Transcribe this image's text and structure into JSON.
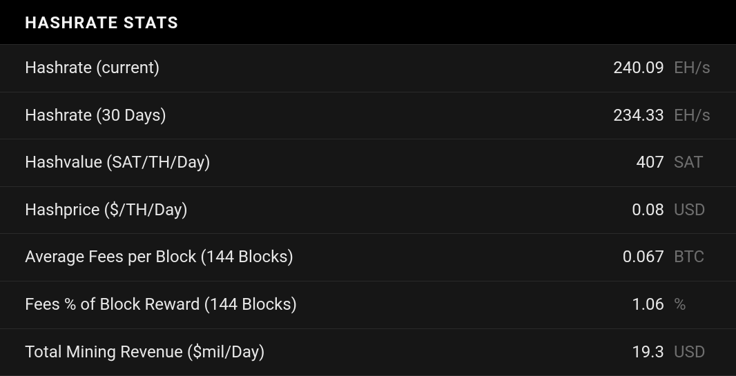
{
  "panel": {
    "title": "HASHRATE STATS",
    "rows": [
      {
        "label": "Hashrate (current)",
        "value": "240.09",
        "unit": "EH/s"
      },
      {
        "label": "Hashrate (30 Days)",
        "value": "234.33",
        "unit": "EH/s"
      },
      {
        "label": "Hashvalue (SAT/TH/Day)",
        "value": "407",
        "unit": "SAT"
      },
      {
        "label": "Hashprice ($/TH/Day)",
        "value": "0.08",
        "unit": "USD"
      },
      {
        "label": "Average Fees per Block (144 Blocks)",
        "value": "0.067",
        "unit": "BTC"
      },
      {
        "label": "Fees % of Block Reward (144 Blocks)",
        "value": "1.06",
        "unit": "%"
      },
      {
        "label": "Total Mining Revenue ($mil/Day)",
        "value": "19.3",
        "unit": "USD"
      }
    ]
  }
}
